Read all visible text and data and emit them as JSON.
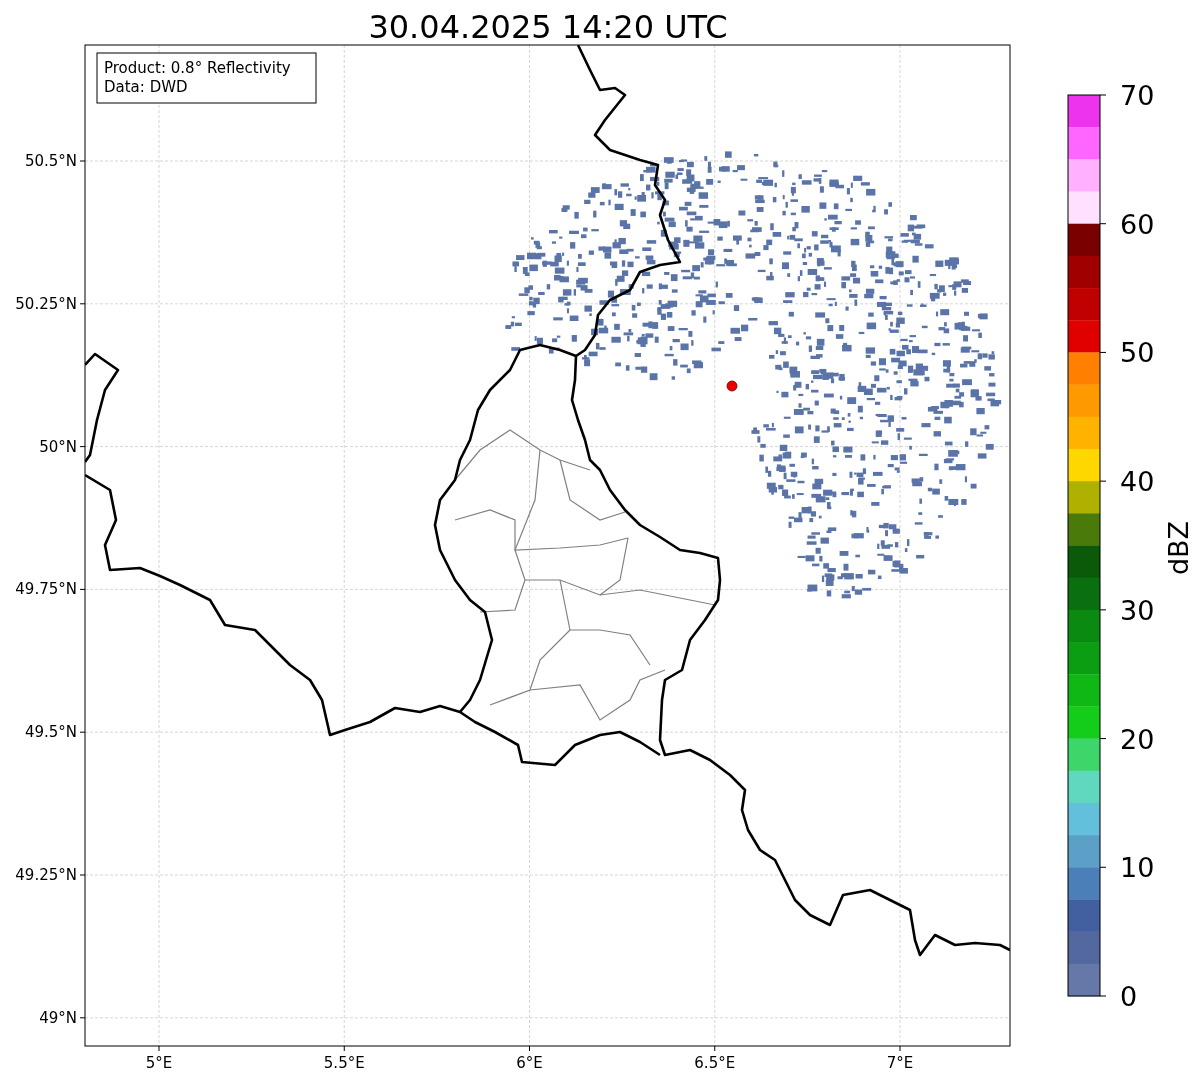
{
  "title": "30.04.2025 14:20 UTC",
  "info_box": [
    "Product: 0.8° Reflectivity",
    "Data: DWD"
  ],
  "map": {
    "xticks": [
      "5°E",
      "5.5°E",
      "6°E",
      "6.5°E",
      "7°E"
    ],
    "yticks": [
      "50.5°N",
      "50.25°N",
      "50°N",
      "49.75°N",
      "49.5°N",
      "49.25°N",
      "49°N"
    ]
  },
  "colorbar": {
    "label": "dBZ",
    "ticks": [
      "70",
      "60",
      "50",
      "40",
      "30",
      "20",
      "10",
      "0"
    ],
    "segments": [
      {
        "color": "#ee33ee"
      },
      {
        "color": "#ff66ff"
      },
      {
        "color": "#ffb0ff"
      },
      {
        "color": "#ffe0ff"
      },
      {
        "color": "#7a0000"
      },
      {
        "color": "#a00000"
      },
      {
        "color": "#c00000"
      },
      {
        "color": "#e00000"
      },
      {
        "color": "#ff8000"
      },
      {
        "color": "#ff9900"
      },
      {
        "color": "#ffb300"
      },
      {
        "color": "#ffd700"
      },
      {
        "color": "#b0b000"
      },
      {
        "color": "#4a7a0a"
      },
      {
        "color": "#0a5a0a"
      },
      {
        "color": "#0a700f"
      },
      {
        "color": "#0a8a10"
      },
      {
        "color": "#0c9e12"
      },
      {
        "color": "#10b815"
      },
      {
        "color": "#14cc1a"
      },
      {
        "color": "#3dd66a"
      },
      {
        "color": "#60d8c0"
      },
      {
        "color": "#62c0dc"
      },
      {
        "color": "#5ca0c8"
      },
      {
        "color": "#4a7fb8"
      },
      {
        "color": "#4260a0"
      },
      {
        "color": "#5468a0"
      },
      {
        "color": "#6678a8"
      }
    ]
  }
}
